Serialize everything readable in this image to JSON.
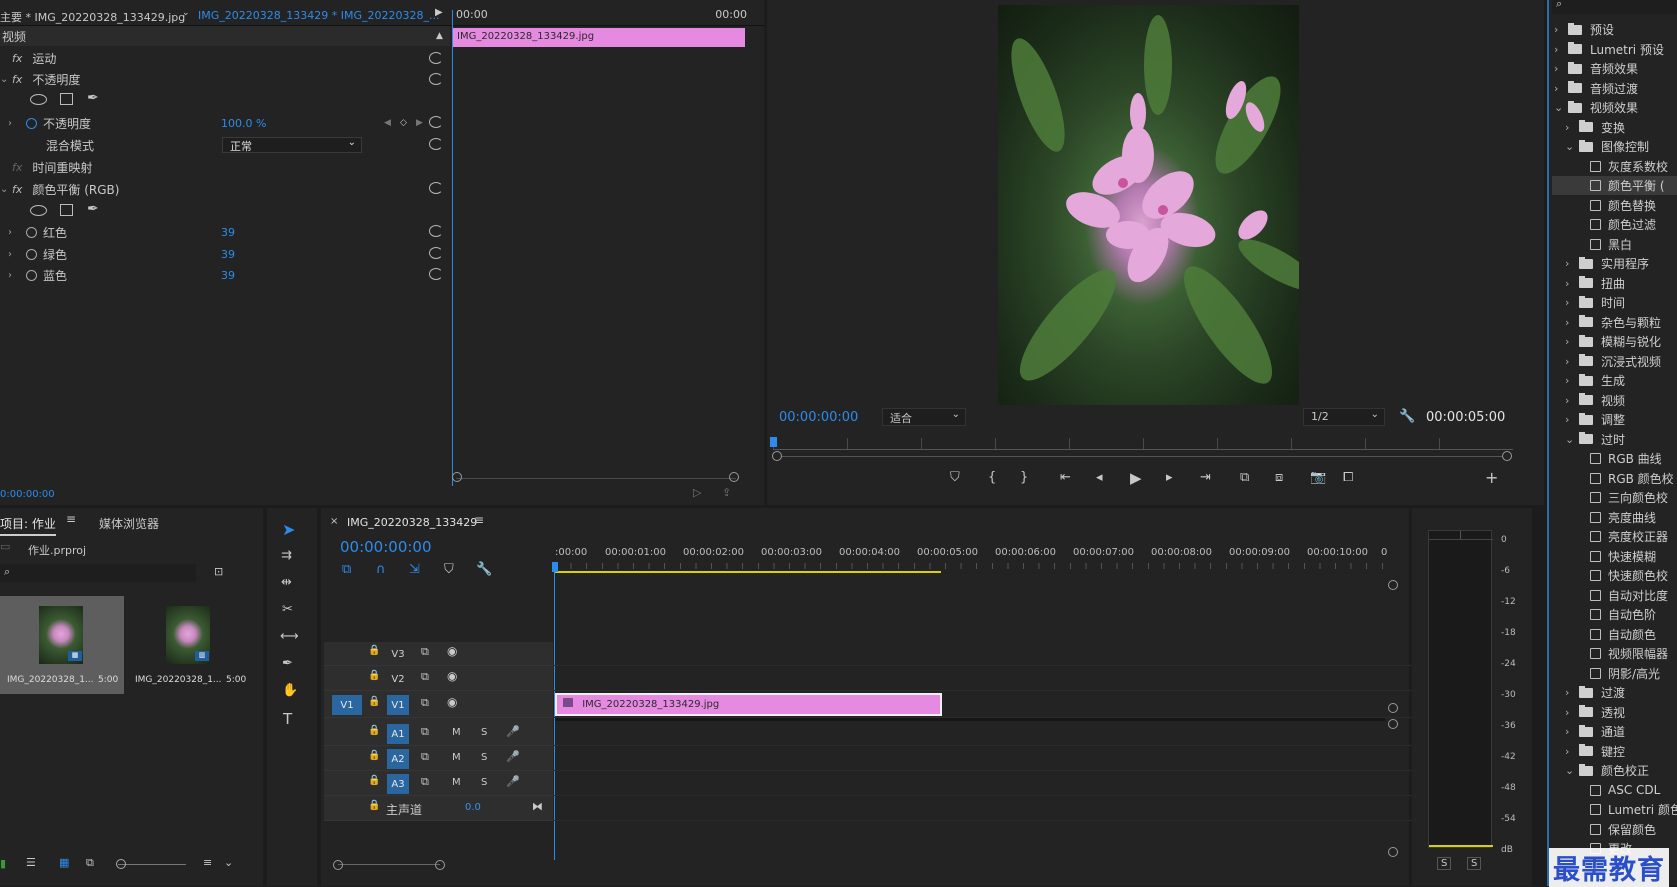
{
  "effect_controls": {
    "tab1": "主要 * IMG_20220328_133429.jpg",
    "tab2": "IMG_20220328_133429 * IMG_20220328_...",
    "section": "视频",
    "rows": [
      {
        "label": "运动"
      },
      {
        "label": "不透明度"
      },
      {
        "label": "不透明度",
        "value": "100.0 %"
      },
      {
        "label": "混合模式",
        "value": "正常"
      },
      {
        "label": "时间重映射"
      },
      {
        "label": "颜色平衡 (RGB)"
      },
      {
        "label": "红色",
        "value": "39"
      },
      {
        "label": "绿色",
        "value": "39"
      },
      {
        "label": "蓝色",
        "value": "39"
      }
    ],
    "time_start": "00:00",
    "time_end": "00:00",
    "clip_name": "IMG_20220328_133429.jpg",
    "timecode": "0:00:00:00"
  },
  "program": {
    "timecode": "00:00:00:00",
    "fit": "适合",
    "resolution": "1/2",
    "duration": "00:00:05:00"
  },
  "project": {
    "tab_project": "项目: 作业",
    "tab_media": "媒体浏览器",
    "file": "作业.prproj",
    "items": [
      {
        "name": "IMG_20220328_1...",
        "dur": "5:00"
      },
      {
        "name": "IMG_20220328_1...",
        "dur": "5:00"
      }
    ]
  },
  "timeline": {
    "title": "IMG_20220328_133429",
    "timecode": "00:00:00:00",
    "ruler": [
      ":00:00",
      "00:00:01:00",
      "00:00:02:00",
      "00:00:03:00",
      "00:00:04:00",
      "00:00:05:00",
      "00:00:06:00",
      "00:00:07:00",
      "00:00:08:00",
      "00:00:09:00",
      "00:00:10:00",
      "0"
    ],
    "video_tracks": [
      "V3",
      "V2",
      "V1"
    ],
    "source_patch": "V1",
    "audio_tracks": [
      "A1",
      "A2",
      "A3"
    ],
    "master_label": "主声道",
    "master_value": "0.0",
    "clip_name": "IMG_20220328_133429.jpg",
    "mute": "M",
    "solo": "S"
  },
  "meter": {
    "labels": [
      "0",
      "-6",
      "-12",
      "-18",
      "-24",
      "-30",
      "-36",
      "-42",
      "-48",
      "-54",
      "dB"
    ],
    "s1": "S",
    "s2": "S"
  },
  "effects_panel": {
    "items": [
      {
        "label": "预设",
        "type": "preset",
        "exp": false
      },
      {
        "label": "Lumetri 预设",
        "type": "preset",
        "exp": false
      },
      {
        "label": "音频效果",
        "type": "folder",
        "exp": false
      },
      {
        "label": "音频过渡",
        "type": "folder",
        "exp": false
      },
      {
        "label": "视频效果",
        "type": "folder",
        "exp": true
      },
      {
        "label": "变换",
        "type": "folder",
        "exp": false
      },
      {
        "label": "图像控制",
        "type": "folder",
        "exp": true
      },
      {
        "label": "灰度系数校",
        "type": "fx"
      },
      {
        "label": "颜色平衡 (",
        "type": "fx",
        "sel": true
      },
      {
        "label": "颜色替换",
        "type": "fx"
      },
      {
        "label": "颜色过滤",
        "type": "fx"
      },
      {
        "label": "黑白",
        "type": "fx"
      },
      {
        "label": "实用程序",
        "type": "folder",
        "exp": false
      },
      {
        "label": "扭曲",
        "type": "folder",
        "exp": false
      },
      {
        "label": "时间",
        "type": "folder",
        "exp": false
      },
      {
        "label": "杂色与颗粒",
        "type": "folder",
        "exp": false
      },
      {
        "label": "模糊与锐化",
        "type": "folder",
        "exp": false
      },
      {
        "label": "沉浸式视频",
        "type": "folder",
        "exp": false
      },
      {
        "label": "生成",
        "type": "folder",
        "exp": false
      },
      {
        "label": "视频",
        "type": "folder",
        "exp": false
      },
      {
        "label": "调整",
        "type": "folder",
        "exp": false
      },
      {
        "label": "过时",
        "type": "folder",
        "exp": true
      },
      {
        "label": "RGB 曲线",
        "type": "fx"
      },
      {
        "label": "RGB 颜色校",
        "type": "fx"
      },
      {
        "label": "三向颜色校",
        "type": "fx"
      },
      {
        "label": "亮度曲线",
        "type": "fx"
      },
      {
        "label": "亮度校正器",
        "type": "fx"
      },
      {
        "label": "快速模糊",
        "type": "fx"
      },
      {
        "label": "快速颜色校",
        "type": "fx"
      },
      {
        "label": "自动对比度",
        "type": "fx"
      },
      {
        "label": "自动色阶",
        "type": "fx"
      },
      {
        "label": "自动颜色",
        "type": "fx"
      },
      {
        "label": "视频限幅器",
        "type": "fx"
      },
      {
        "label": "阴影/高光",
        "type": "fx"
      },
      {
        "label": "过渡",
        "type": "folder",
        "exp": false
      },
      {
        "label": "透视",
        "type": "folder",
        "exp": false
      },
      {
        "label": "通道",
        "type": "folder",
        "exp": false
      },
      {
        "label": "键控",
        "type": "folder",
        "exp": false
      },
      {
        "label": "颜色校正",
        "type": "folder",
        "exp": true
      },
      {
        "label": "ASC CDL",
        "type": "fx"
      },
      {
        "label": "Lumetri 颜色",
        "type": "fx"
      },
      {
        "label": "保留颜色",
        "type": "fx"
      },
      {
        "label": "更改",
        "type": "fx"
      }
    ]
  },
  "watermark": "最需教育",
  "colors": {
    "clip": "#e58ae0",
    "accent": "#2d8ceb",
    "yellow": "#d8d000"
  }
}
